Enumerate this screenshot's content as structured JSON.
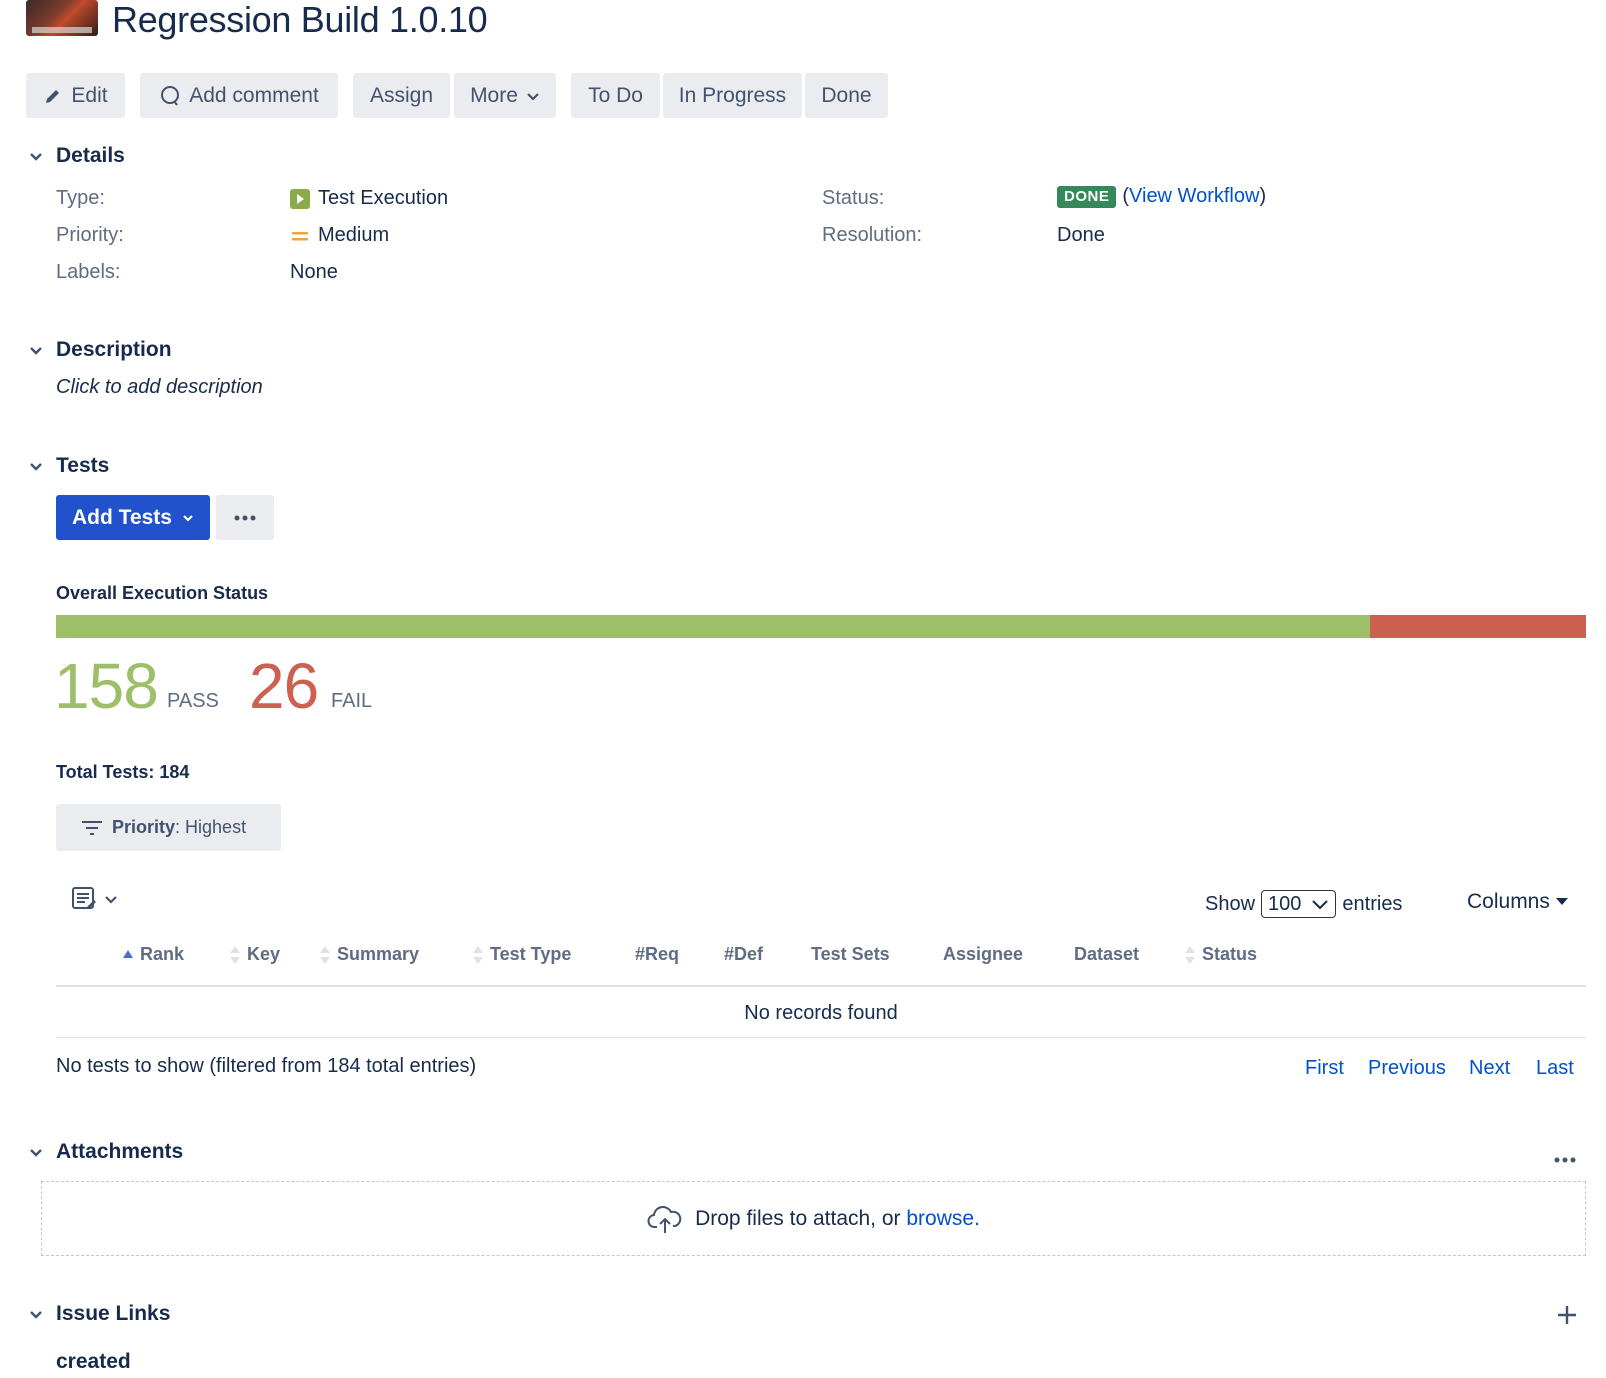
{
  "header": {
    "title": "Regression Build 1.0.10"
  },
  "toolbar": {
    "edit": "Edit",
    "add_comment": "Add comment",
    "assign": "Assign",
    "more": "More",
    "todo": "To Do",
    "in_progress": "In Progress",
    "done": "Done"
  },
  "details": {
    "title": "Details",
    "type_label": "Type:",
    "type_value": "Test Execution",
    "priority_label": "Priority:",
    "priority_value": "Medium",
    "labels_label": "Labels:",
    "labels_value": "None",
    "status_label": "Status:",
    "status_value": "DONE",
    "view_workflow": "View Workflow",
    "resolution_label": "Resolution:",
    "resolution_value": "Done"
  },
  "description": {
    "title": "Description",
    "placeholder": "Click to add description"
  },
  "tests": {
    "title": "Tests",
    "add_tests": "Add Tests",
    "overall_label": "Overall Execution Status",
    "pass_count": "158",
    "pass_label": "PASS",
    "fail_count": "26",
    "fail_label": "FAIL",
    "pass_fraction": 0.8587,
    "total": "Total Tests: 184",
    "filter_key": "Priority",
    "filter_value": ": Highest",
    "show_label": "Show",
    "entries_value": "100",
    "entries_label": "entries",
    "columns_label": "Columns",
    "columns": [
      "Rank",
      "Key",
      "Summary",
      "Test Type",
      "#Req",
      "#Def",
      "Test Sets",
      "Assignee",
      "Dataset",
      "Status"
    ],
    "empty": "No records found",
    "info": "No tests to show (filtered from 184 total entries)",
    "pager": {
      "first": "First",
      "previous": "Previous",
      "next": "Next",
      "last": "Last"
    }
  },
  "attachments": {
    "title": "Attachments",
    "drop_text": "Drop files to attach, or",
    "browse": "browse."
  },
  "issue_links": {
    "title": "Issue Links",
    "created": "created"
  },
  "colors": {
    "pass": "#9dbf6a",
    "fail": "#cc6152",
    "primary": "#2251cc",
    "link": "#0052cc"
  }
}
